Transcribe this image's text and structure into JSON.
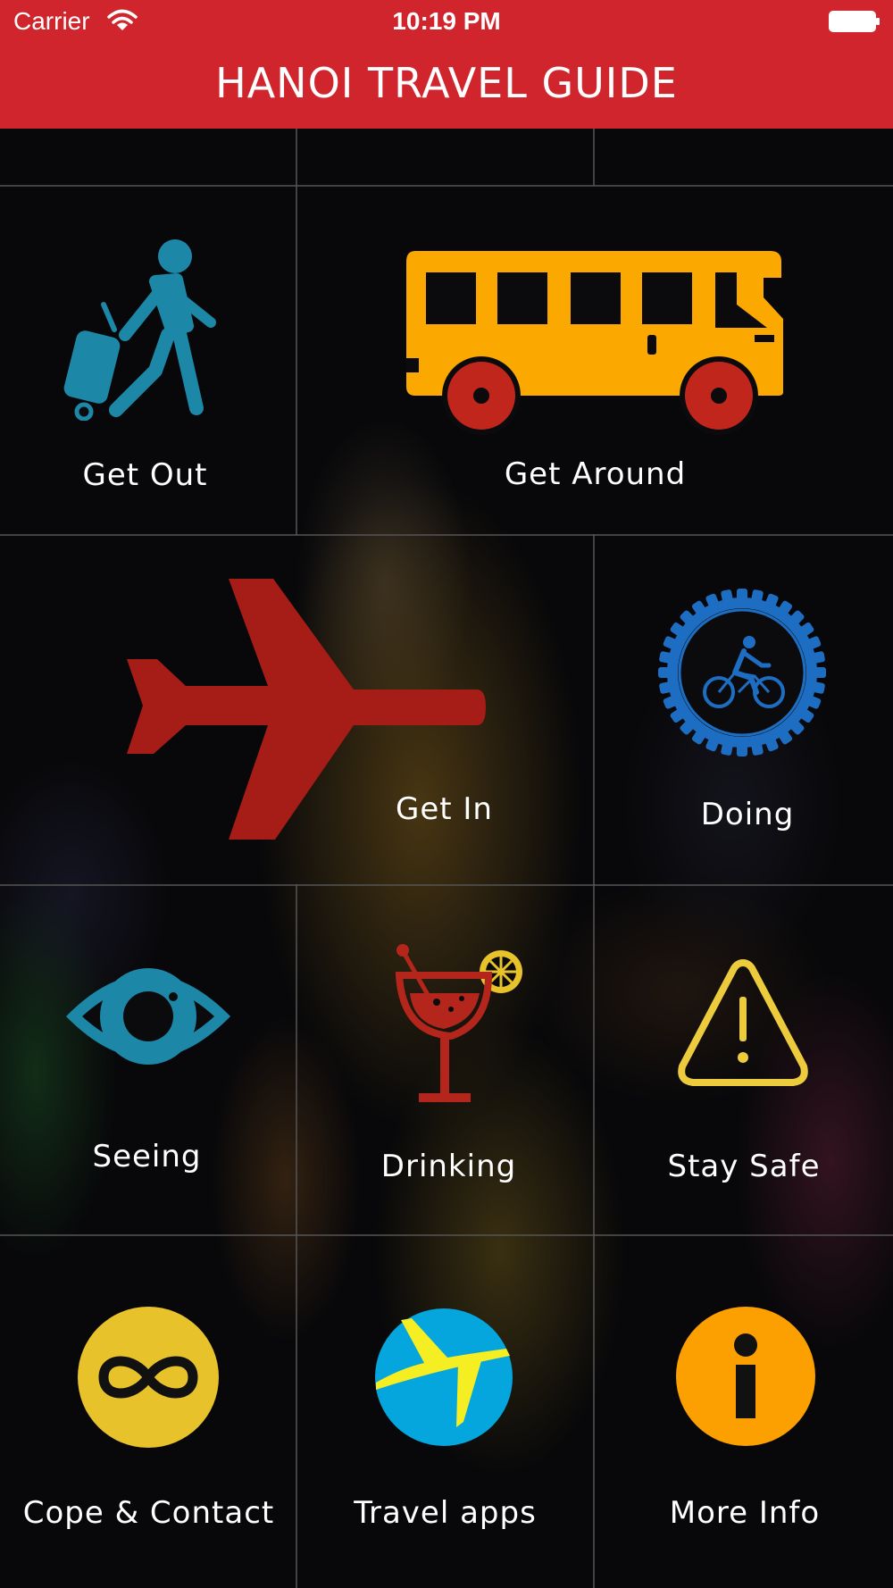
{
  "status_bar": {
    "carrier": "Carrier",
    "time": "10:19 PM"
  },
  "header": {
    "title": "HANOI TRAVEL GUIDE"
  },
  "tiles": {
    "get_out": {
      "label": "Get Out",
      "icon": "traveler-luggage-icon",
      "color": "#1d87a8"
    },
    "get_around": {
      "label": "Get Around",
      "icon": "bus-icon",
      "color": "#fba800"
    },
    "get_in": {
      "label": "Get In",
      "icon": "airplane-icon",
      "color": "#a51d16"
    },
    "doing": {
      "label": "Doing",
      "icon": "cycling-gear-icon",
      "color": "#1d6ec2"
    },
    "seeing": {
      "label": "Seeing",
      "icon": "eye-icon",
      "color": "#1d87a8"
    },
    "drinking": {
      "label": "Drinking",
      "icon": "cocktail-icon",
      "color": "#b4261c"
    },
    "stay_safe": {
      "label": "Stay Safe",
      "icon": "warning-icon",
      "color": "#eccb3d"
    },
    "cope_contact": {
      "label": "Cope & Contact",
      "icon": "infinity-icon",
      "color": "#e8c22a"
    },
    "travel_apps": {
      "label": "Travel apps",
      "icon": "expedia-plane-icon",
      "color": "#04a6dd"
    },
    "more_info": {
      "label": "More Info",
      "icon": "info-icon",
      "color": "#fba000"
    }
  }
}
